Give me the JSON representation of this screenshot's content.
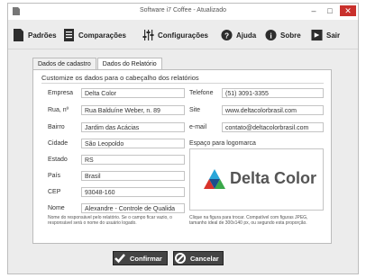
{
  "window": {
    "title": "Software i7 Coffee - Atualizado"
  },
  "toolbar": {
    "items": [
      {
        "label": "Padrões"
      },
      {
        "label": "Comparações"
      },
      {
        "label": "Configurações"
      },
      {
        "label": "Ajuda"
      },
      {
        "label": "Sobre"
      },
      {
        "label": "Sair"
      }
    ]
  },
  "tabs": [
    {
      "label": "Dados de cadastro"
    },
    {
      "label": "Dados do Relatório"
    }
  ],
  "heading": "Customize os dados para o cabeçalho dos relatórios",
  "fields": {
    "empresa": {
      "label": "Empresa",
      "value": "Delta Color"
    },
    "rua": {
      "label": "Rua, nº",
      "value": "Rua Balduíne Weber, n. 89"
    },
    "bairro": {
      "label": "Bairro",
      "value": "Jardim das Acácias"
    },
    "cidade": {
      "label": "Cidade",
      "value": "São Leopoldo"
    },
    "estado": {
      "label": "Estado",
      "value": "RS"
    },
    "pais": {
      "label": "País",
      "value": "Brasil"
    },
    "cep": {
      "label": "CEP",
      "value": "93048-160"
    },
    "nome": {
      "label": "Nome",
      "value": "Alexandre - Controle de Qualida"
    },
    "telefone": {
      "label": "Telefone",
      "value": "(51) 3091-3355"
    },
    "site": {
      "label": "Site",
      "value": "www.deltacolorbrasil.com"
    },
    "email": {
      "label": "e-mail",
      "value": "contato@deltacolorbrasil.com"
    }
  },
  "logo_label": "Espaço para logomarca",
  "logo_text": "Delta Color",
  "notes": {
    "left": "Nome do responsável pelo relatório. Se o campo ficar vazio, o responsável será o nome do usuário logado.",
    "right": "Clique na figura para trocar. Compatível com figuras JPEG, tamanho ideal de 300x140 px, ou segundo esta proporção."
  },
  "buttons": {
    "confirm": "Confirmar",
    "cancel": "Cancelar"
  },
  "colors": {
    "window_bg": "#ececec",
    "button_bg": "#444444",
    "close_red": "#c9302c"
  }
}
